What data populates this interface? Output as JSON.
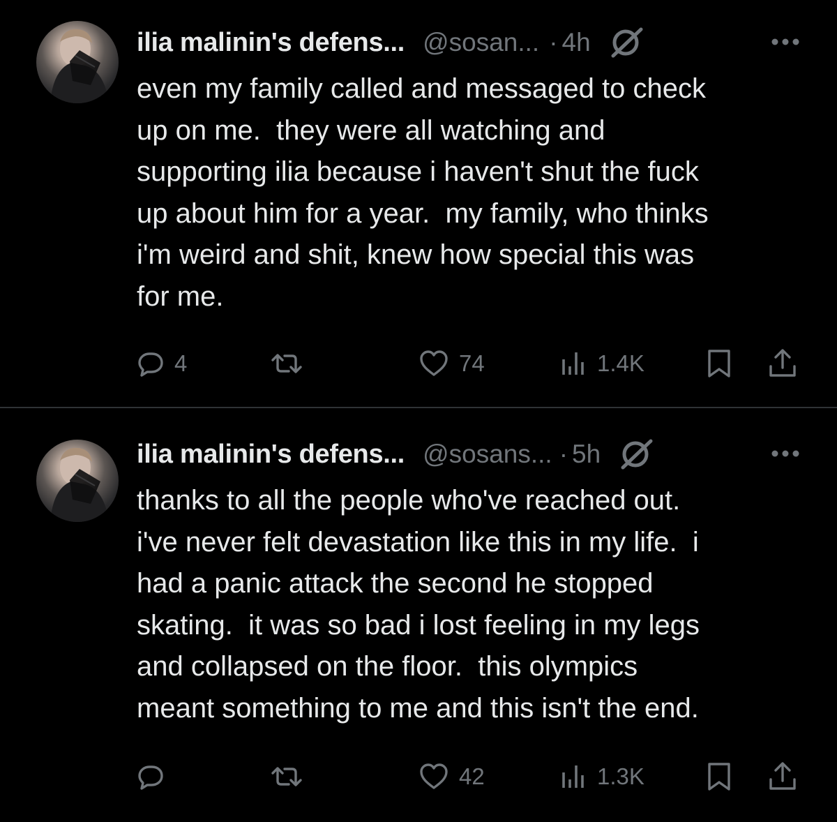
{
  "tweets": [
    {
      "display_name": "ilia malinin's defens...",
      "handle": "@sosan...",
      "separator": "·",
      "time": "4h",
      "text": "even my family called and messaged to check\nup on me.  they were all watching and\nsupporting ilia because i haven't shut the fuck\nup about him for a year.  my family, who thinks\ni'm weird and shit, knew how special this was\nfor me.",
      "replies": "4",
      "retweets": "",
      "likes": "74",
      "views": "1.4K"
    },
    {
      "display_name": "ilia malinin's defens...",
      "handle": "@sosans...",
      "separator": "·",
      "time": "5h",
      "text": "thanks to all the people who've reached out.\ni've never felt devastation like this in my life.  i\nhad a panic attack the second he stopped\nskating.  it was so bad i lost feeling in my legs\nand collapsed on the floor.  this olympics\nmeant something to me and this isn't the end.",
      "replies": "",
      "retweets": "",
      "likes": "42",
      "views": "1.3K"
    }
  ],
  "icons": [
    "avatar",
    "status-icon",
    "more-icon",
    "reply-icon",
    "retweet-icon",
    "like-icon",
    "views-icon",
    "bookmark-icon",
    "share-icon"
  ],
  "colors": {
    "background": "#000000",
    "text_primary": "#e7e9ea",
    "text_secondary": "#71767b",
    "divider": "#2f3336"
  }
}
